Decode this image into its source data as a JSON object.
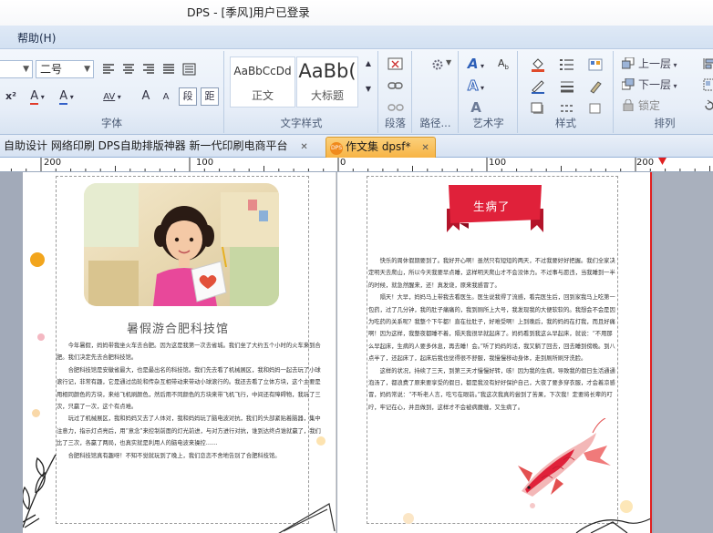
{
  "window": {
    "title": "DPS - [季风]用户已登录"
  },
  "menu": {
    "help": "帮助(H)"
  },
  "ribbon": {
    "font_group_label": "字体",
    "font_size_value": "二号",
    "char_spacing_label": "AV",
    "segment_label": "段",
    "distance_label": "距",
    "styles_group_label": "文字样式",
    "style_normal_sample": "AaBbCcDd",
    "style_normal_name": "正文",
    "style_heading_sample": "AaBb(",
    "style_heading_name": "大标题",
    "paragraph_group_label": "段落",
    "path_group_label": "路径...",
    "art_text_group_label": "艺术字",
    "style_group_label": "样式",
    "arrange_group_label": "排列",
    "bring_forward_label": "上一层",
    "send_backward_label": "下一层",
    "lock_label": "锁定"
  },
  "tabs": {
    "plain_label": "自助设计 网络印刷 DPS自助排版神器 新一代印刷电商平台",
    "active_label": "作文集 dpsf*",
    "active_badge": "DPS"
  },
  "ruler": {
    "labels": [
      "200",
      "100",
      "0",
      "100",
      "200"
    ]
  },
  "left_page": {
    "article_title": "暑假游合肥科技馆",
    "paragraphs": [
      "今年暑假，妈妈带我坐火车去合肥。因为这是我第一次去省城。我们坐了大约五个小时的火车来到合肥。我们决定先去合肥科技馆。",
      "合肥科技馆是安徽省最大，也是最出名的科技馆。我们先去看了机械展区，我和妈妈一起去玩了小球滚行记，非常有趣，它是通过齿轮和传杂互相带动来带动小球滚行的。我还去看了立体方块，这个主要是用相同颜色的方块，来给飞机刷颜色，然后用不同颜色的方块来带飞机飞行，中间还有障碍物，我玩了三次，只赢了一次，这个有点难。",
      "玩过了机械展区，我和妈妈又去了人体对，我和妈妈玩了脑电波对抗，我们的头部紧贴着脑器，集中注意力，指示灯点亮后，用“意念”来控制前面的灯光前进，与对方进行对抗，谁到达终点谁就赢了，我们比了三次，各赢了两局，也真实就是利用人的脑电波来操控……",
      "合肥科技馆真有趣呀！不知不觉就玩到了晚上，我们恋恋不舍地告别了合肥科技馆。"
    ]
  },
  "right_page": {
    "banner_title": "生病了",
    "paragraphs": [
      "快乐的周休假期要到了。我好开心啊！虽然只有短短的两天，不过我要好好把握。我们全家决定明天去爬山，所以今天我要早点睡，这样明天爬山才不会没体力。不过事与愿违，当我睡到一半的时候，就急然醒来，还！真发烧，原来我感冒了。",
      "隔天！大早，妈妈马上带我去看医生。医生说我得了流感，看完医生后，回到家我马上吃第一包药，过了几分钟，我的肚子痛痛的，我到厕所上大号，我发现我的大便软软的。我想会不会是因为吃药的关系呢？我整个下午都！直在拉肚子，好难受啊！上到晚后，我的妈妈在打我，而且好痛啊！因为这样，我整夜都睡不着，隔天我很早就起床了。妈妈看到我这么早起床，就说：“不用那么早起床，生病的人要多休息，再去睡！会。”听了妈妈的话，我又躺了回去，回去睡到傍晚。到八点半了，还起床了，起床后我也觉得很不舒服，我慢慢移动身体，走到厕所刷牙洗脸。",
      "这样的状况，持续了三天，到第三天才慢慢好转，咳！因为我的生病，导致我的假日生活通通泡汤了，都浪费了原来要享受的假日，都是我没有好好保护自己，大夜了要多穿衣服，才会着凉感冒，妈妈常说：“不听老人言，吃亏在眼前。”我这次我真的尝到了苦果，下次我！定要将长辈的叮咛，牢记在心，并且做到，这样才不会被病魔缠，又生病了。"
    ]
  },
  "colors": {
    "accent_orange": "#f7b445",
    "ribbon_blue": "#dfe9f6",
    "banner_red": "#e0213a",
    "workspace_gray": "#a2aab9"
  }
}
